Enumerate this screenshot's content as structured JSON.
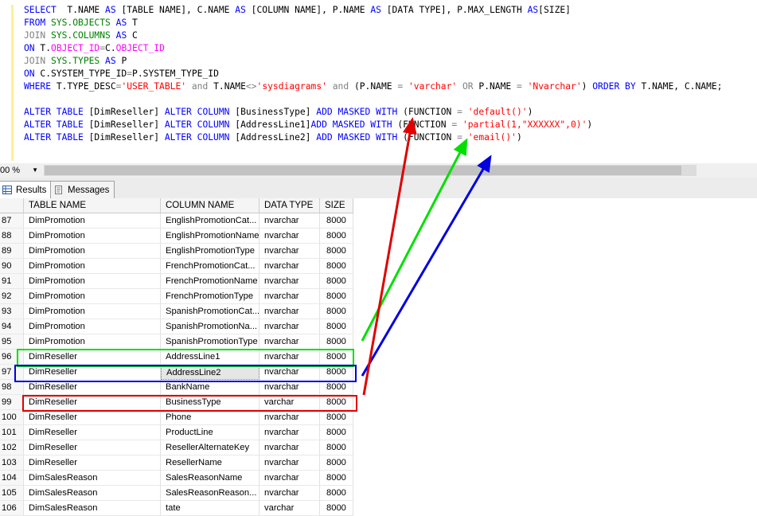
{
  "editor": {
    "lines": [
      [
        [
          "kw",
          "SELECT  "
        ],
        [
          "",
          "T.NAME "
        ],
        [
          "kw",
          "AS "
        ],
        [
          "",
          "[TABLE NAME], C.NAME "
        ],
        [
          "kw",
          "AS "
        ],
        [
          "",
          "[COLUMN NAME], P.NAME "
        ],
        [
          "kw",
          "AS "
        ],
        [
          "",
          "[DATA TYPE], P.MAX_LENGTH "
        ],
        [
          "kw",
          "AS"
        ],
        [
          "",
          "[SIZE]"
        ]
      ],
      [
        [
          "kw",
          "FROM "
        ],
        [
          "tbl",
          "SYS.OBJECTS "
        ],
        [
          "kw",
          "AS "
        ],
        [
          "",
          "T"
        ]
      ],
      [
        [
          "gray",
          "JOIN "
        ],
        [
          "tbl",
          "SYS.COLUMNS "
        ],
        [
          "kw",
          "AS "
        ],
        [
          "",
          "C"
        ]
      ],
      [
        [
          "kw",
          "ON "
        ],
        [
          "",
          "T."
        ],
        [
          "obj",
          "OBJECT_ID"
        ],
        [
          "gray",
          "="
        ],
        [
          "",
          "C."
        ],
        [
          "obj",
          "OBJECT_ID"
        ]
      ],
      [
        [
          "gray",
          "JOIN "
        ],
        [
          "tbl",
          "SYS.TYPES "
        ],
        [
          "kw",
          "AS "
        ],
        [
          "",
          "P"
        ]
      ],
      [
        [
          "kw",
          "ON "
        ],
        [
          "",
          "C.SYSTEM_TYPE_ID"
        ],
        [
          "gray",
          "="
        ],
        [
          "",
          "P.SYSTEM_TYPE_ID"
        ]
      ],
      [
        [
          "kw",
          "WHERE "
        ],
        [
          "",
          "T.TYPE_DESC"
        ],
        [
          "gray",
          "="
        ],
        [
          "str",
          "'USER_TABLE' "
        ],
        [
          "gray",
          "and "
        ],
        [
          "",
          "T.NAME"
        ],
        [
          "gray",
          "<>"
        ],
        [
          "str",
          "'sysdiagrams' "
        ],
        [
          "gray",
          "and "
        ],
        [
          "",
          "(P.NAME "
        ],
        [
          "gray",
          "= "
        ],
        [
          "str",
          "'varchar' "
        ],
        [
          "gray",
          "OR "
        ],
        [
          "",
          "P.NAME "
        ],
        [
          "gray",
          "= "
        ],
        [
          "str",
          "'Nvarchar'"
        ],
        [
          "",
          ") "
        ],
        [
          "kw",
          "ORDER BY "
        ],
        [
          "",
          "T.NAME, C.NAME;"
        ]
      ],
      [
        [
          "",
          ""
        ]
      ],
      [
        [
          "kw",
          "ALTER TABLE "
        ],
        [
          "",
          "[DimReseller] "
        ],
        [
          "kw",
          "ALTER COLUMN "
        ],
        [
          "",
          "[BusinessType] "
        ],
        [
          "kw",
          "ADD MASKED WITH "
        ],
        [
          "",
          "(FUNCTION "
        ],
        [
          "gray",
          "= "
        ],
        [
          "str",
          "'default()'"
        ],
        [
          "",
          ")"
        ]
      ],
      [
        [
          "kw",
          "ALTER TABLE "
        ],
        [
          "",
          "[DimReseller] "
        ],
        [
          "kw",
          "ALTER COLUMN "
        ],
        [
          "",
          "[AddressLine1]"
        ],
        [
          "kw",
          "ADD MASKED WITH "
        ],
        [
          "",
          "(FUNCTION "
        ],
        [
          "gray",
          "= "
        ],
        [
          "str",
          "'partial(1,\"XXXXXX\",0)'"
        ],
        [
          "",
          ")"
        ]
      ],
      [
        [
          "kw",
          "ALTER TABLE "
        ],
        [
          "",
          "[DimReseller] "
        ],
        [
          "kw",
          "ALTER COLUMN "
        ],
        [
          "",
          "[AddressLine2] "
        ],
        [
          "kw",
          "ADD MASKED WITH "
        ],
        [
          "",
          "(FUNCTION "
        ],
        [
          "gray",
          "= "
        ],
        [
          "str",
          "'email()'"
        ],
        [
          "",
          ")"
        ]
      ]
    ]
  },
  "status": {
    "zoom": "00 %"
  },
  "tabs": [
    {
      "label": "Results",
      "icon": "grid-icon",
      "active": true
    },
    {
      "label": "Messages",
      "icon": "messages-icon",
      "active": false
    }
  ],
  "grid": {
    "headers": [
      "",
      "TABLE NAME",
      "COLUMN NAME",
      "DATA TYPE",
      "SIZE"
    ],
    "rows": [
      [
        "87",
        "DimPromotion",
        "EnglishPromotionCat...",
        "nvarchar",
        "8000"
      ],
      [
        "88",
        "DimPromotion",
        "EnglishPromotionName",
        "nvarchar",
        "8000"
      ],
      [
        "89",
        "DimPromotion",
        "EnglishPromotionType",
        "nvarchar",
        "8000"
      ],
      [
        "90",
        "DimPromotion",
        "FrenchPromotionCat...",
        "nvarchar",
        "8000"
      ],
      [
        "91",
        "DimPromotion",
        "FrenchPromotionName",
        "nvarchar",
        "8000"
      ],
      [
        "92",
        "DimPromotion",
        "FrenchPromotionType",
        "nvarchar",
        "8000"
      ],
      [
        "93",
        "DimPromotion",
        "SpanishPromotionCat...",
        "nvarchar",
        "8000"
      ],
      [
        "94",
        "DimPromotion",
        "SpanishPromotionNa...",
        "nvarchar",
        "8000"
      ],
      [
        "95",
        "DimPromotion",
        "SpanishPromotionType",
        "nvarchar",
        "8000"
      ],
      [
        "96",
        "DimReseller",
        "AddressLine1",
        "nvarchar",
        "8000"
      ],
      [
        "97",
        "DimReseller",
        "AddressLine2",
        "nvarchar",
        "8000"
      ],
      [
        "98",
        "DimReseller",
        "BankName",
        "nvarchar",
        "8000"
      ],
      [
        "99",
        "DimReseller",
        "BusinessType",
        "varchar",
        "8000"
      ],
      [
        "100",
        "DimReseller",
        "Phone",
        "nvarchar",
        "8000"
      ],
      [
        "101",
        "DimReseller",
        "ProductLine",
        "nvarchar",
        "8000"
      ],
      [
        "102",
        "DimReseller",
        "ResellerAlternateKey",
        "nvarchar",
        "8000"
      ],
      [
        "103",
        "DimReseller",
        "ResellerName",
        "nvarchar",
        "8000"
      ],
      [
        "104",
        "DimSalesReason",
        "SalesReasonName",
        "nvarchar",
        "8000"
      ],
      [
        "105",
        "DimSalesReason",
        "SalesReasonReason...",
        "nvarchar",
        "8000"
      ],
      [
        "106",
        "DimSalesReason",
        "tate",
        "varchar",
        "8000"
      ]
    ],
    "selected_row": 10
  },
  "annotations": {
    "colors": {
      "green": "#00e000",
      "blue": "#0000e0",
      "red": "#e00000"
    }
  }
}
